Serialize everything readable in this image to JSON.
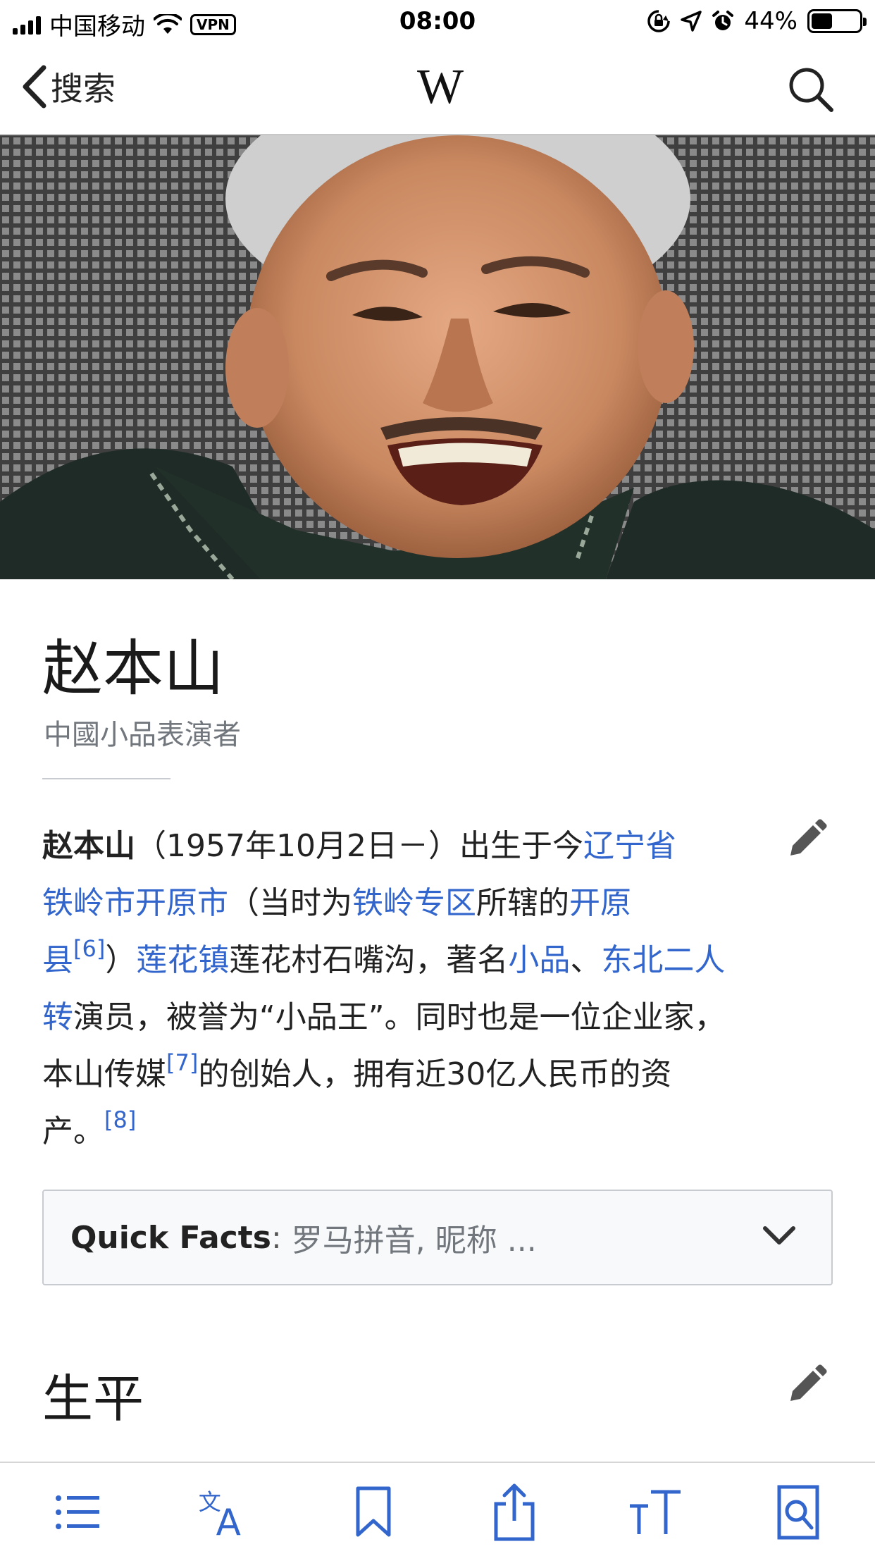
{
  "status_bar": {
    "carrier": "中国移动",
    "vpn": "VPN",
    "time": "08:00",
    "battery_percent": "44%",
    "battery_level": 0.44
  },
  "nav": {
    "back_label": "搜索",
    "logo": "W"
  },
  "article": {
    "title": "赵本山",
    "description": "中國小品表演者",
    "paragraph": {
      "l1_bold": "赵本山",
      "l1_text": "（1957年10月2日－）出生于今",
      "l1_link": "辽宁省",
      "l2_link1": "铁岭市开原市",
      "l2_text1": "（当时为",
      "l2_link2": "铁岭专区",
      "l2_text2": "所辖的",
      "l2_link3": "开原",
      "l3_link1": "县",
      "l3_ref": "[6]",
      "l3_text1": "）",
      "l3_link2": "莲花镇",
      "l3_text2": "莲花村石嘴沟，著名",
      "l3_link3": "小品",
      "l3_text3": "、",
      "l3_link4": "东北二人",
      "l4_link": "转",
      "l4_text": "演员，被誉为“小品王”。同时也是一位企业家，",
      "l5_text1": "本山传媒",
      "l5_ref": "[7]",
      "l5_text2": "的创始人，拥有近30亿人民币的资",
      "l6_text": "产。",
      "l6_ref": "[8]"
    },
    "quick_facts": {
      "label": "Quick Facts",
      "colon": ":",
      "preview": "罗马拼音, 昵称 ..."
    },
    "section_heading": "生平"
  },
  "colors": {
    "link": "#3366cc",
    "toolbar_icon": "#3366cc",
    "text": "#222222",
    "muted": "#72777d"
  },
  "toolbar": {
    "icons": [
      "table-of-contents-icon",
      "languages-icon",
      "bookmark-icon",
      "share-icon",
      "text-size-icon",
      "find-in-page-icon"
    ]
  }
}
